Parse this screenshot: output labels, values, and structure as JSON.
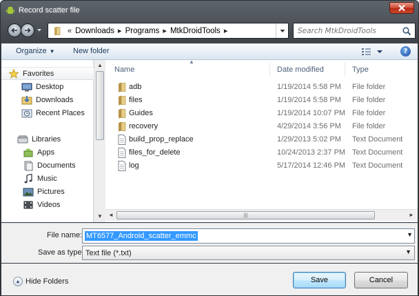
{
  "window": {
    "title": "Record scatter  file",
    "icons": {
      "app": "android-icon",
      "close": "close-icon"
    }
  },
  "address": {
    "prefix": "«",
    "segments": [
      "Downloads",
      "Programs",
      "MtkDroidTools"
    ],
    "search_placeholder": "Search MtkDroidTools"
  },
  "toolbar": {
    "organize_label": "Organize",
    "new_folder_label": "New folder",
    "help_label": "?"
  },
  "nav": {
    "favorites_label": "Favorites",
    "favorites": [
      "Desktop",
      "Downloads",
      "Recent Places"
    ],
    "libraries_label": "Libraries",
    "libraries": [
      "Apps",
      "Documents",
      "Music",
      "Pictures",
      "Videos"
    ]
  },
  "columns": {
    "name": "Name",
    "date": "Date modified",
    "type": "Type"
  },
  "files": [
    {
      "name": "adb",
      "date": "1/19/2014 5:58 PM",
      "type": "File folder",
      "icon": "folder-icon"
    },
    {
      "name": "files",
      "date": "1/19/2014 5:58 PM",
      "type": "File folder",
      "icon": "folder-icon"
    },
    {
      "name": "Guides",
      "date": "1/19/2014 10:07 PM",
      "type": "File folder",
      "icon": "folder-icon"
    },
    {
      "name": "recovery",
      "date": "4/29/2014 3:56 PM",
      "type": "File folder",
      "icon": "folder-icon"
    },
    {
      "name": "build_prop_replace",
      "date": "1/29/2013 5:02 PM",
      "type": "Text Document",
      "icon": "text-file-icon"
    },
    {
      "name": "files_for_delete",
      "date": "10/24/2013 2:37 PM",
      "type": "Text Document",
      "icon": "text-file-icon"
    },
    {
      "name": "log",
      "date": "5/17/2014 12:46 PM",
      "type": "Text Document",
      "icon": "text-file-icon"
    }
  ],
  "form": {
    "filename_label": "File name:",
    "filename_value": "MT6577_Android_scatter_emmc",
    "savetype_label": "Save as type:",
    "savetype_value": "Text file (*.txt)"
  },
  "buttons": {
    "hide_folders": "Hide Folders",
    "save": "Save",
    "cancel": "Cancel"
  },
  "colors": {
    "selection": "#3399ff",
    "toolbar_text": "#1e395b",
    "header_text": "#4c607a"
  }
}
